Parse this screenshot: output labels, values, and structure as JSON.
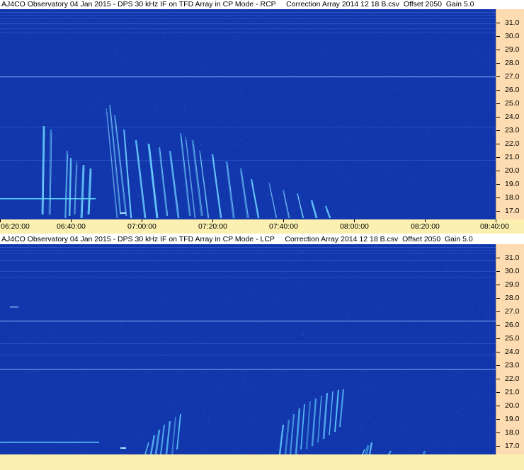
{
  "panels": [
    {
      "id": "top",
      "title": "AJ4CO Observatory 04 Jan 2015 - DPS 30 kHz IF on TFD Array in CP Mode - RCP     Correction Array 2014 12 18 B.csv  Offset 2050  Gain 5.0",
      "x_labels": [
        "06:20:00",
        "06:40:00",
        "07:00:00",
        "07:20:00",
        "07:40:00",
        "08:00:00",
        "08:20:00",
        "08:40:00"
      ],
      "y_labels": [
        "31.0",
        "30.0",
        "29.0",
        "28.0",
        "27.0",
        "26.0",
        "25.0",
        "24.0",
        "23.0",
        "22.0",
        "21.0",
        "20.0",
        "19.0",
        "18.0",
        "17.0"
      ]
    },
    {
      "id": "bottom",
      "title": "AJ4CO Observatory 04 Jan 2015 - DPS 30 kHz IF on TFD Array in CP Mode - LCP     Correction Array 2014 12 18 B.csv  Offset 2050  Gain 5.0",
      "x_labels": [],
      "y_labels": [
        "31.0",
        "30.0",
        "29.0",
        "28.0",
        "27.0",
        "26.0",
        "25.0",
        "24.0",
        "23.0",
        "22.0",
        "21.0",
        "20.0",
        "19.0",
        "18.0",
        "17.0"
      ]
    }
  ],
  "colors": {
    "background_blue": "#1035a8",
    "dark_band": "#061a6a",
    "emission": "#6fd0ff",
    "y_axis_bg": "#fcdcb0",
    "x_axis_bg": "#fcf0b0"
  }
}
